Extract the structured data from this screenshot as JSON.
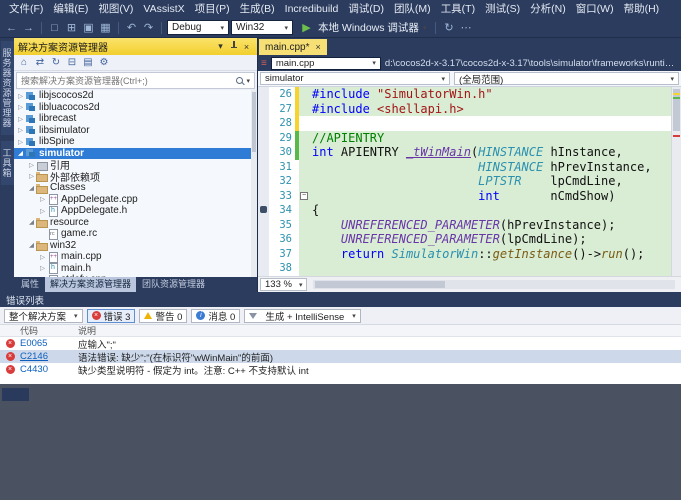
{
  "colors": {
    "chrome": "#2c3c5e",
    "selection_blue": "#2f7cd6",
    "active_header_yellow": "#f2cf2e",
    "error_red": "#d93a3a",
    "change_yellow": "#f6d32d",
    "change_green": "#58b849",
    "code_highlight_green": "#d9ecd4"
  },
  "icons": {
    "back": "←",
    "forward": "→",
    "new_file": "□",
    "open": "⊞",
    "save": "▣",
    "save_all": "▦",
    "undo": "↶",
    "redo": "↷",
    "run": "▶",
    "chevron_down": "▾",
    "close": "×",
    "more": "⋯",
    "home": "⌂",
    "sync": "⇄",
    "refresh": "↻",
    "collapse_all": "⊟",
    "properties": "⚙",
    "show_all": "▤",
    "menu": "≡"
  },
  "menu": {
    "items": [
      "文件(F)",
      "编辑(E)",
      "视图(V)",
      "VAssistX",
      "项目(P)",
      "生成(B)",
      "Incredibuild",
      "调试(D)",
      "团队(M)",
      "工具(T)",
      "测试(S)",
      "分析(N)",
      "窗口(W)",
      "帮助(H)"
    ]
  },
  "toolbar": {
    "config": "Debug",
    "platform": "Win32",
    "run_label": "本地 Windows 调试器"
  },
  "left_strip": {
    "tabs": [
      "服务器资源管理器",
      "工具箱"
    ]
  },
  "solution_explorer": {
    "title": "解决方案资源管理器",
    "search_placeholder": "搜索解决方案资源管理器(Ctrl+;)",
    "tree": [
      {
        "label": "libjscocos2d",
        "depth": 1,
        "icon": "cpp-project",
        "expander": "collapsed"
      },
      {
        "label": "libluacocos2d",
        "depth": 1,
        "icon": "cpp-project",
        "expander": "collapsed"
      },
      {
        "label": "librecast",
        "depth": 1,
        "icon": "cpp-project",
        "expander": "collapsed"
      },
      {
        "label": "libsimulator",
        "depth": 1,
        "icon": "cpp-project",
        "expander": "collapsed"
      },
      {
        "label": "libSpine",
        "depth": 1,
        "icon": "cpp-project",
        "expander": "collapsed"
      },
      {
        "label": "simulator",
        "depth": 1,
        "icon": "cpp-project",
        "expander": "expanded",
        "selected": true
      },
      {
        "label": "引用",
        "depth": 2,
        "icon": "references",
        "expander": "collapsed"
      },
      {
        "label": "外部依赖项",
        "depth": 2,
        "icon": "folder",
        "expander": "collapsed"
      },
      {
        "label": "Classes",
        "depth": 2,
        "icon": "folder",
        "expander": "expanded"
      },
      {
        "label": "AppDelegate.cpp",
        "depth": 3,
        "icon": "cpp-file",
        "expander": "collapsed"
      },
      {
        "label": "AppDelegate.h",
        "depth": 3,
        "icon": "h-file",
        "expander": "collapsed"
      },
      {
        "label": "resource",
        "depth": 2,
        "icon": "folder",
        "expander": "expanded"
      },
      {
        "label": "game.rc",
        "depth": 3,
        "icon": "rc-file"
      },
      {
        "label": "win32",
        "depth": 2,
        "icon": "folder",
        "expander": "expanded"
      },
      {
        "label": "main.cpp",
        "depth": 3,
        "icon": "cpp-file",
        "expander": "collapsed"
      },
      {
        "label": "main.h",
        "depth": 3,
        "icon": "h-file",
        "expander": "collapsed"
      },
      {
        "label": "stdafx.cpp",
        "depth": 3,
        "icon": "cpp-file",
        "expander": "collapsed"
      }
    ],
    "bottom_tabs": [
      "属性",
      "解决方案资源管理器",
      "团队资源管理器"
    ],
    "active_bottom_tab": 1
  },
  "editor": {
    "tab": {
      "title": "main.cpp*"
    },
    "navbar": {
      "file_combo": "main.cpp",
      "path": "d:\\cocos2d-x-3.17\\cocos2d-x-3.17\\tools\\simulator\\frameworks\\runtime-src\\...",
      "project_combo": "simulator",
      "scope": "(全局范围)"
    },
    "zoom": "133 %",
    "code": {
      "lines": [
        {
          "no": 26,
          "margin": "yellow",
          "hl": true,
          "tokens": [
            [
              "pp",
              "#include"
            ],
            [
              "plain",
              " "
            ],
            [
              "str",
              "\"SimulatorWin.h\""
            ]
          ]
        },
        {
          "no": 27,
          "margin": "yellow",
          "hl": true,
          "tokens": [
            [
              "pp",
              "#include"
            ],
            [
              "plain",
              " "
            ],
            [
              "str",
              "<shellapi.h>"
            ]
          ]
        },
        {
          "no": 28,
          "margin": "yellow",
          "hl": false,
          "tokens": []
        },
        {
          "no": 29,
          "margin": "green",
          "hl": true,
          "tokens": [
            [
              "comment",
              "//APIENTRY"
            ]
          ]
        },
        {
          "no": 30,
          "margin": "green",
          "hl": true,
          "tokens": [
            [
              "kw",
              "int"
            ],
            [
              "plain",
              " APIENTRY "
            ],
            [
              "macrofn",
              "_tWinMain"
            ],
            [
              "plain",
              "("
            ],
            [
              "type",
              "HINSTANCE"
            ],
            [
              "plain",
              " hInstance,"
            ]
          ]
        },
        {
          "no": 31,
          "hl": true,
          "tokens": [
            [
              "plain",
              "                       "
            ],
            [
              "type",
              "HINSTANCE"
            ],
            [
              "plain",
              " hPrevInstance,"
            ]
          ]
        },
        {
          "no": 32,
          "hl": true,
          "tokens": [
            [
              "plain",
              "                       "
            ],
            [
              "type",
              "LPTSTR"
            ],
            [
              "plain",
              "    lpCmdLine,"
            ]
          ]
        },
        {
          "no": 33,
          "hl": true,
          "fold": true,
          "tokens": [
            [
              "plain",
              "                       "
            ],
            [
              "kw",
              "int"
            ],
            [
              "plain",
              "       nCmdShow)"
            ]
          ]
        },
        {
          "no": 34,
          "hl": true,
          "marker": true,
          "tokens": [
            [
              "plain",
              "{"
            ]
          ]
        },
        {
          "no": 35,
          "hl": true,
          "tokens": [
            [
              "plain",
              "    "
            ],
            [
              "macro",
              "UNREFERENCED_PARAMETER"
            ],
            [
              "plain",
              "(hPrevInstance);"
            ]
          ]
        },
        {
          "no": 36,
          "hl": true,
          "tokens": [
            [
              "plain",
              "    "
            ],
            [
              "macro",
              "UNREFERENCED_PARAMETER"
            ],
            [
              "plain",
              "(lpCmdLine);"
            ]
          ]
        },
        {
          "no": 37,
          "hl": true,
          "tokens": [
            [
              "plain",
              "    "
            ],
            [
              "kw",
              "return"
            ],
            [
              "plain",
              " "
            ],
            [
              "type",
              "SimulatorWin"
            ],
            [
              "plain",
              "::"
            ],
            [
              "method",
              "getInstance"
            ],
            [
              "plain",
              "()->"
            ],
            [
              "method",
              "run"
            ],
            [
              "plain",
              "();"
            ]
          ]
        },
        {
          "no": 38,
          "hl": true,
          "tokens": []
        }
      ]
    }
  },
  "error_list": {
    "tab": "错误列表",
    "scope": "整个解决方案",
    "errors_label": "错误 3",
    "warnings_label": "警告 0",
    "messages_label": "消息 0",
    "source": "生成 + IntelliSense",
    "columns": [
      "代码",
      "说明"
    ],
    "rows": [
      {
        "code": "E0065",
        "desc": "应输入\";\"",
        "selected": false,
        "underline": false
      },
      {
        "code": "C2146",
        "desc": "语法错误: 缺少\";\"(在标识符\"wWinMain\"的前面)",
        "selected": true,
        "underline": true
      },
      {
        "code": "C4430",
        "desc": "缺少类型说明符 - 假定为 int。注意: C++ 不支持默认 int",
        "selected": false,
        "underline": false
      }
    ]
  }
}
